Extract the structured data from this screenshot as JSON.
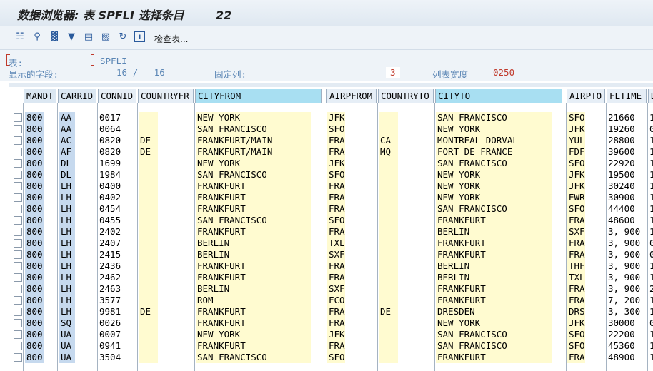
{
  "window": {
    "title": "数据浏览器: 表 SPFLI 选择条目        22"
  },
  "toolbar": {
    "icons": [
      "glasses-icon",
      "find-icon",
      "filter-icon",
      "sort-icon",
      "export-icon",
      "print-icon",
      "refresh-icon",
      "info-icon"
    ],
    "check_table_label": "检查表..."
  },
  "header": {
    "table_label": "表:",
    "table_value": "SPFLI",
    "fields_label": "显示的字段:",
    "fields_value": "16 /   16",
    "fixed_cols_label": "固定列:",
    "fixed_cols_value": "3",
    "list_width_label": "列表宽度",
    "list_width_value": "0250"
  },
  "grid": {
    "columns": [
      "MANDT",
      "CARRID",
      "CONNID",
      "COUNTRYFR",
      "CITYFROM",
      "AIRPFROM",
      "COUNTRYTO",
      "CITYTO",
      "AIRPTO",
      "FLTIME",
      "D"
    ],
    "rows": [
      [
        "800",
        "AA",
        "0017",
        "",
        "NEW YORK",
        "JFK",
        "",
        "SAN FRANCISCO",
        "SFO",
        "21660",
        "1"
      ],
      [
        "800",
        "AA",
        "0064",
        "",
        "SAN FRANCISCO",
        "SFO",
        "",
        "NEW YORK",
        "JFK",
        "19260",
        "0"
      ],
      [
        "800",
        "AC",
        "0820",
        "DE",
        "FRANKFURT/MAIN",
        "FRA",
        "CA",
        "MONTREAL-DORVAL",
        "YUL",
        "28800",
        "1"
      ],
      [
        "800",
        "AF",
        "0820",
        "DE",
        "FRANKFURT/MAIN",
        "FRA",
        "MQ",
        "FORT DE FRANCE",
        "FDF",
        "39600",
        "1"
      ],
      [
        "800",
        "DL",
        "1699",
        "",
        "NEW YORK",
        "JFK",
        "",
        "SAN FRANCISCO",
        "SFO",
        "22920",
        "1"
      ],
      [
        "800",
        "DL",
        "1984",
        "",
        "SAN FRANCISCO",
        "SFO",
        "",
        "NEW YORK",
        "JFK",
        "19500",
        "1"
      ],
      [
        "800",
        "LH",
        "0400",
        "",
        "FRANKFURT",
        "FRA",
        "",
        "NEW YORK",
        "JFK",
        "30240",
        "1"
      ],
      [
        "800",
        "LH",
        "0402",
        "",
        "FRANKFURT",
        "FRA",
        "",
        "NEW YORK",
        "EWR",
        "30900",
        "1"
      ],
      [
        "800",
        "LH",
        "0454",
        "",
        "FRANKFURT",
        "FRA",
        "",
        "SAN FRANCISCO",
        "SFO",
        "44400",
        "1"
      ],
      [
        "800",
        "LH",
        "0455",
        "",
        "SAN FRANCISCO",
        "SFO",
        "",
        "FRANKFURT",
        "FRA",
        "48600",
        "1"
      ],
      [
        "800",
        "LH",
        "2402",
        "",
        "FRANKFURT",
        "FRA",
        "",
        "BERLIN",
        "SXF",
        "3, 900",
        "1"
      ],
      [
        "800",
        "LH",
        "2407",
        "",
        "BERLIN",
        "TXL",
        "",
        "FRANKFURT",
        "FRA",
        "3, 900",
        "0"
      ],
      [
        "800",
        "LH",
        "2415",
        "",
        "BERLIN",
        "SXF",
        "",
        "FRANKFURT",
        "FRA",
        "3, 900",
        "0"
      ],
      [
        "800",
        "LH",
        "2436",
        "",
        "FRANKFURT",
        "FRA",
        "",
        "BERLIN",
        "THF",
        "3, 900",
        "1"
      ],
      [
        "800",
        "LH",
        "2462",
        "",
        "FRANKFURT",
        "FRA",
        "",
        "BERLIN",
        "TXL",
        "3, 900",
        "1"
      ],
      [
        "800",
        "LH",
        "2463",
        "",
        "BERLIN",
        "SXF",
        "",
        "FRANKFURT",
        "FRA",
        "3, 900",
        "2"
      ],
      [
        "800",
        "LH",
        "3577",
        "",
        "ROM",
        "FCO",
        "",
        "FRANKFURT",
        "FRA",
        "7, 200",
        "1"
      ],
      [
        "800",
        "LH",
        "9981",
        "DE",
        "FRANKFURT",
        "FRA",
        "DE",
        "DRESDEN",
        "DRS",
        "3, 300",
        "1"
      ],
      [
        "800",
        "SQ",
        "0026",
        "",
        "FRANKFURT",
        "FRA",
        "",
        "NEW YORK",
        "JFK",
        "30000",
        "0"
      ],
      [
        "800",
        "UA",
        "0007",
        "",
        "NEW YORK",
        "JFK",
        "",
        "SAN FRANCISCO",
        "SFO",
        "22200",
        "1"
      ],
      [
        "800",
        "UA",
        "0941",
        "",
        "FRANKFURT",
        "FRA",
        "",
        "SAN FRANCISCO",
        "SFO",
        "45360",
        "1"
      ],
      [
        "800",
        "UA",
        "3504",
        "",
        "SAN FRANCISCO",
        "SFO",
        "",
        "FRANKFURT",
        "FRA",
        "48900",
        "1"
      ]
    ]
  }
}
